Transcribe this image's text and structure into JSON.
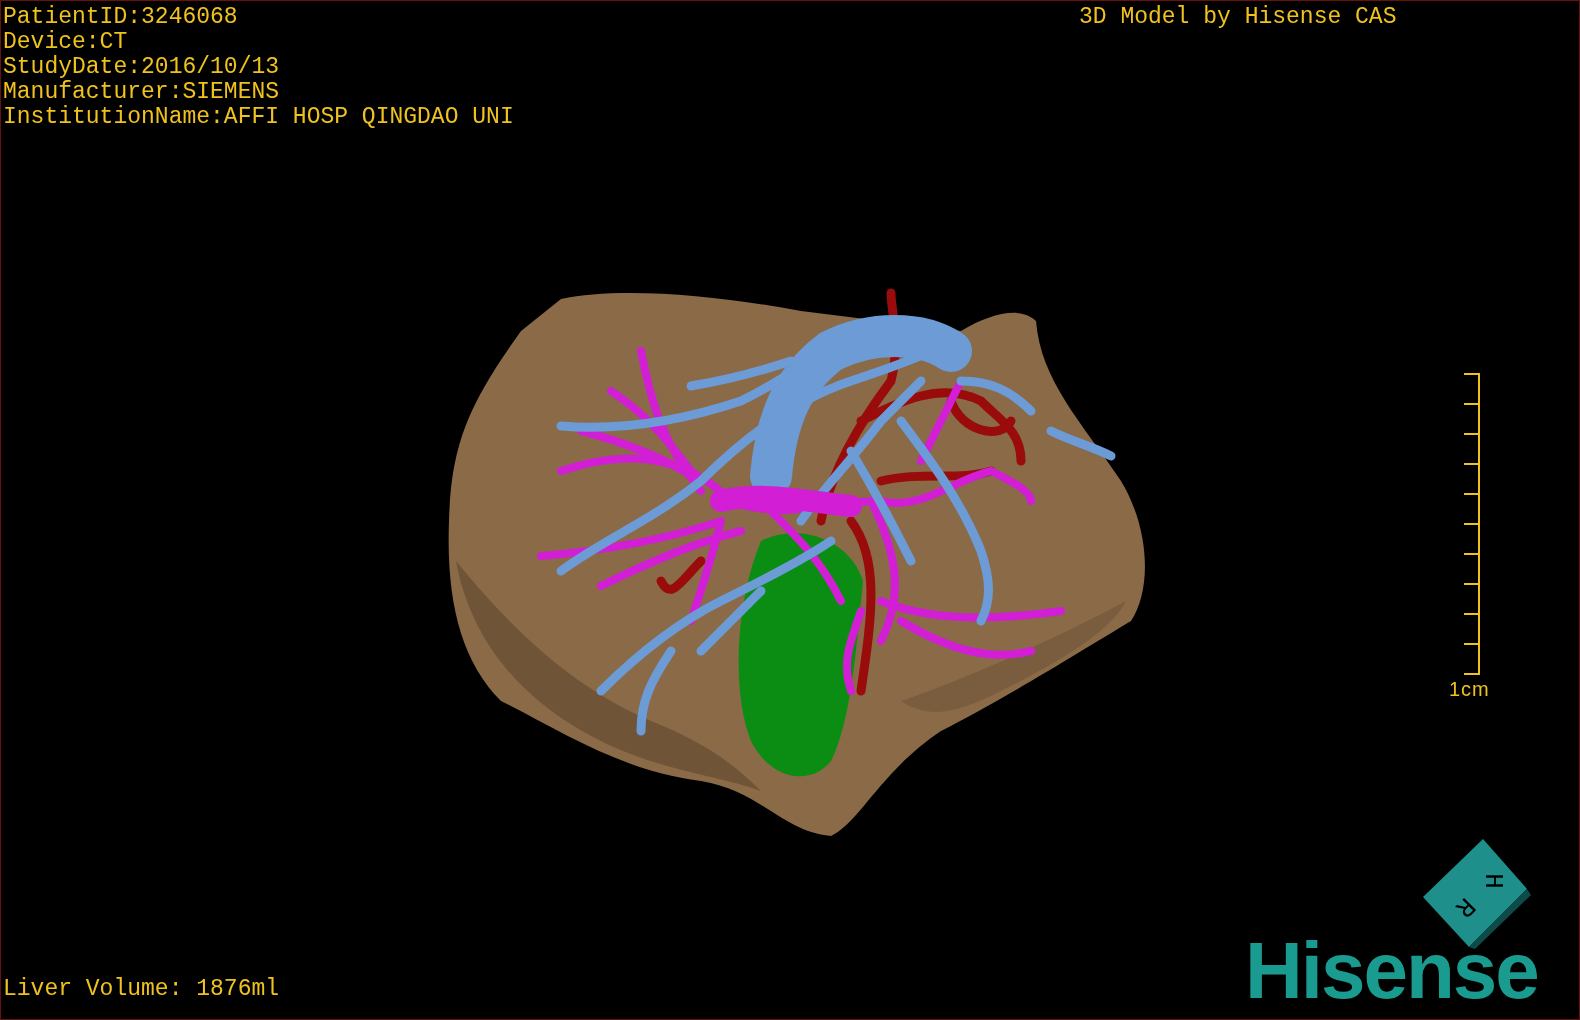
{
  "header": {
    "info_lines": [
      "PatientID:3246068",
      "Device:CT",
      "StudyDate:2016/10/13",
      "Manufacturer:SIEMENS",
      "InstitutionName:AFFI HOSP QINGDAO UNI"
    ],
    "title": "3D Model by Hisense CAS"
  },
  "viewport": {
    "scale_bar": {
      "label": "1cm"
    },
    "orientation_cube": {
      "faces": [
        "H",
        "R"
      ]
    }
  },
  "footer": {
    "liver_volume": "Liver Volume: 1876ml",
    "logo": "Hisense"
  }
}
